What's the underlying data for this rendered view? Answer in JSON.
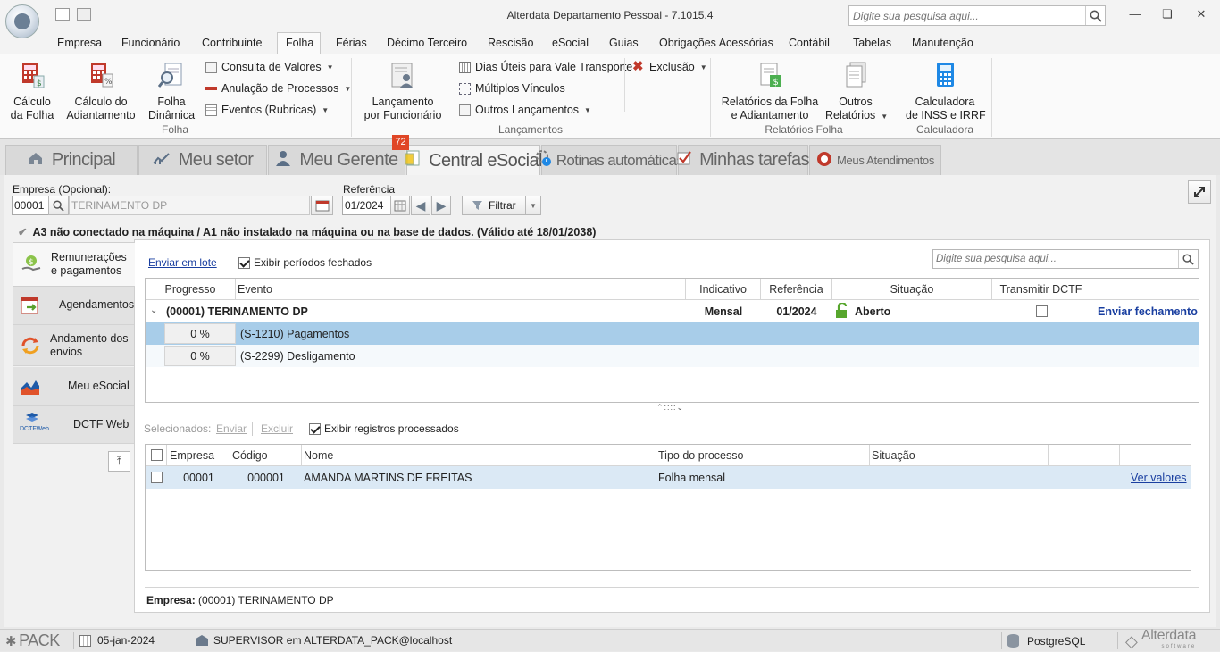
{
  "window": {
    "title": "Alterdata Departamento Pessoal - 7.1015.4",
    "search_placeholder": "Digite sua pesquisa aqui..."
  },
  "menu": [
    "Empresa",
    "Funcionário",
    "Contribuinte",
    "Folha",
    "Férias",
    "Décimo Terceiro",
    "Rescisão",
    "eSocial",
    "Guias",
    "Obrigações Acessórias",
    "Contábil",
    "Tabelas",
    "Manutenção"
  ],
  "menu_active": "Folha",
  "ribbon": {
    "folha": {
      "calculo_folha": "Cálculo\nda Folha",
      "calculo_adiantamento": "Cálculo do\nAdiantamento",
      "folha_dinamica": "Folha\nDinâmica",
      "consulta_valores": "Consulta de Valores",
      "anulacao_processos": "Anulação de Processos",
      "eventos_rubricas": "Eventos (Rubricas)",
      "group_label": "Folha"
    },
    "lancamentos": {
      "lancamento_funcionario": "Lançamento\npor Funcionário",
      "dias_uteis": "Dias Úteis para Vale Transporte",
      "multiplos_vinculos": "Múltiplos Vínculos",
      "outros_lancamentos": "Outros Lançamentos",
      "exclusao": "Exclusão",
      "group_label": "Lançamentos"
    },
    "relatorios": {
      "relatorios_folha": "Relatórios da Folha\ne Adiantamento",
      "outros_relatorios": "Outros\nRelatórios",
      "group_label": "Relatórios Folha"
    },
    "calculadora": {
      "calculadora_inss": "Calculadora\nde INSS e IRRF",
      "group_label": "Calculadora"
    }
  },
  "tabs": {
    "principal": "Principal",
    "meu_setor": "Meu setor",
    "meu_gerente": "Meu Gerente",
    "central_esocial": "Central eSocial",
    "rotinas": "Rotinas automáticas",
    "minhas_tarefas": "Minhas tarefas",
    "meus_atendimentos": "Meus Atendimentos",
    "badge": "72"
  },
  "filters": {
    "empresa_label": "Empresa (Opcional):",
    "empresa_code": "00001",
    "empresa_name": "TERINAMENTO DP",
    "referencia_label": "Referência",
    "referencia_value": "01/2024",
    "filtrar": "Filtrar"
  },
  "certificate_msg": "A3 não conectado na máquina / A1 não instalado na máquina ou na base de dados. (Válido até 18/01/2038)",
  "side_nav": [
    {
      "label": "Remunerações e pagamentos"
    },
    {
      "label": "Agendamentos"
    },
    {
      "label": "Andamento dos envios"
    },
    {
      "label": "Meu eSocial"
    },
    {
      "label": "DCTF Web"
    }
  ],
  "dctf_logo_text": "DCTFWeb",
  "panel": {
    "enviar_lote": "Enviar em lote",
    "exibir_fechados": "Exibir períodos fechados",
    "search_placeholder": "Digite sua pesquisa aqui...",
    "columns": [
      "Progresso",
      "Evento",
      "Indicativo",
      "Referência",
      "Situação",
      "Transmitir DCTF"
    ],
    "group_row": {
      "name": "(00001) TERINAMENTO DP",
      "indicativo": "Mensal",
      "referencia": "01/2024",
      "situacao": "Aberto",
      "action": "Enviar fechamento"
    },
    "event_rows": [
      {
        "progress": "0 %",
        "evento": "(S-1210) Pagamentos"
      },
      {
        "progress": "0 %",
        "evento": "(S-2299) Desligamento"
      }
    ],
    "selecionados": "Selecionados:",
    "enviar": "Enviar",
    "excluir": "Excluir",
    "exibir_processados": "Exibir registros processados",
    "lower_columns": [
      "Empresa",
      "Código",
      "Nome",
      "Tipo do processo",
      "Situação"
    ],
    "lower_rows": [
      {
        "empresa": "00001",
        "codigo": "000001",
        "nome": "AMANDA MARTINS DE FREITAS",
        "tipo": "Folha mensal",
        "situacao": "",
        "action": "Ver valores"
      }
    ],
    "footer_label": "Empresa:",
    "footer_value": "(00001) TERINAMENTO DP"
  },
  "statusbar": {
    "pack": "PACK",
    "date": "05-jan-2024",
    "user": "SUPERVISOR em ALTERDATA_PACK@localhost",
    "db": "PostgreSQL",
    "brand": "Alterdata",
    "brand_sub": "software"
  },
  "colors": {
    "accent_blue": "#1a3fa0",
    "selected_row": "#a8cde9",
    "badge_red": "#e04626",
    "lock_green": "#57a62d"
  }
}
